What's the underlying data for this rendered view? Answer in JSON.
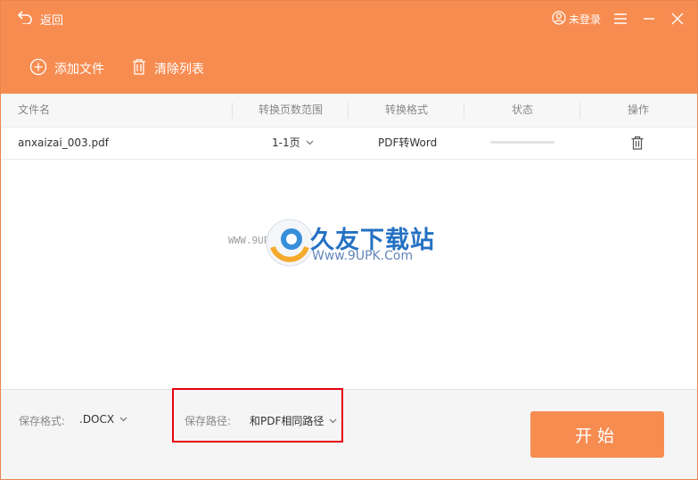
{
  "header": {
    "back_label": "返回",
    "login_label": "未登录",
    "toolbar": {
      "add_label": "添加文件",
      "clear_label": "清除列表"
    }
  },
  "table": {
    "columns": [
      "文件名",
      "转换页数范围",
      "转换格式",
      "状态",
      "操作"
    ],
    "rows": [
      {
        "name": "anxaizai_003.pdf",
        "page_range": "1-1页",
        "format": "PDF转Word",
        "progress": 0
      }
    ]
  },
  "watermark": {
    "main": "久友下载站",
    "url": "Www.9UPK.Com",
    "left": "WWW.9UPK.COM"
  },
  "footer": {
    "format_label": "保存格式:",
    "format_value": ".DOCX",
    "path_label": "保存路径:",
    "path_value": "和PDF相同路径",
    "start_label": "开始"
  },
  "colors": {
    "accent": "#f78c51",
    "highlight_box": "#e60012"
  }
}
